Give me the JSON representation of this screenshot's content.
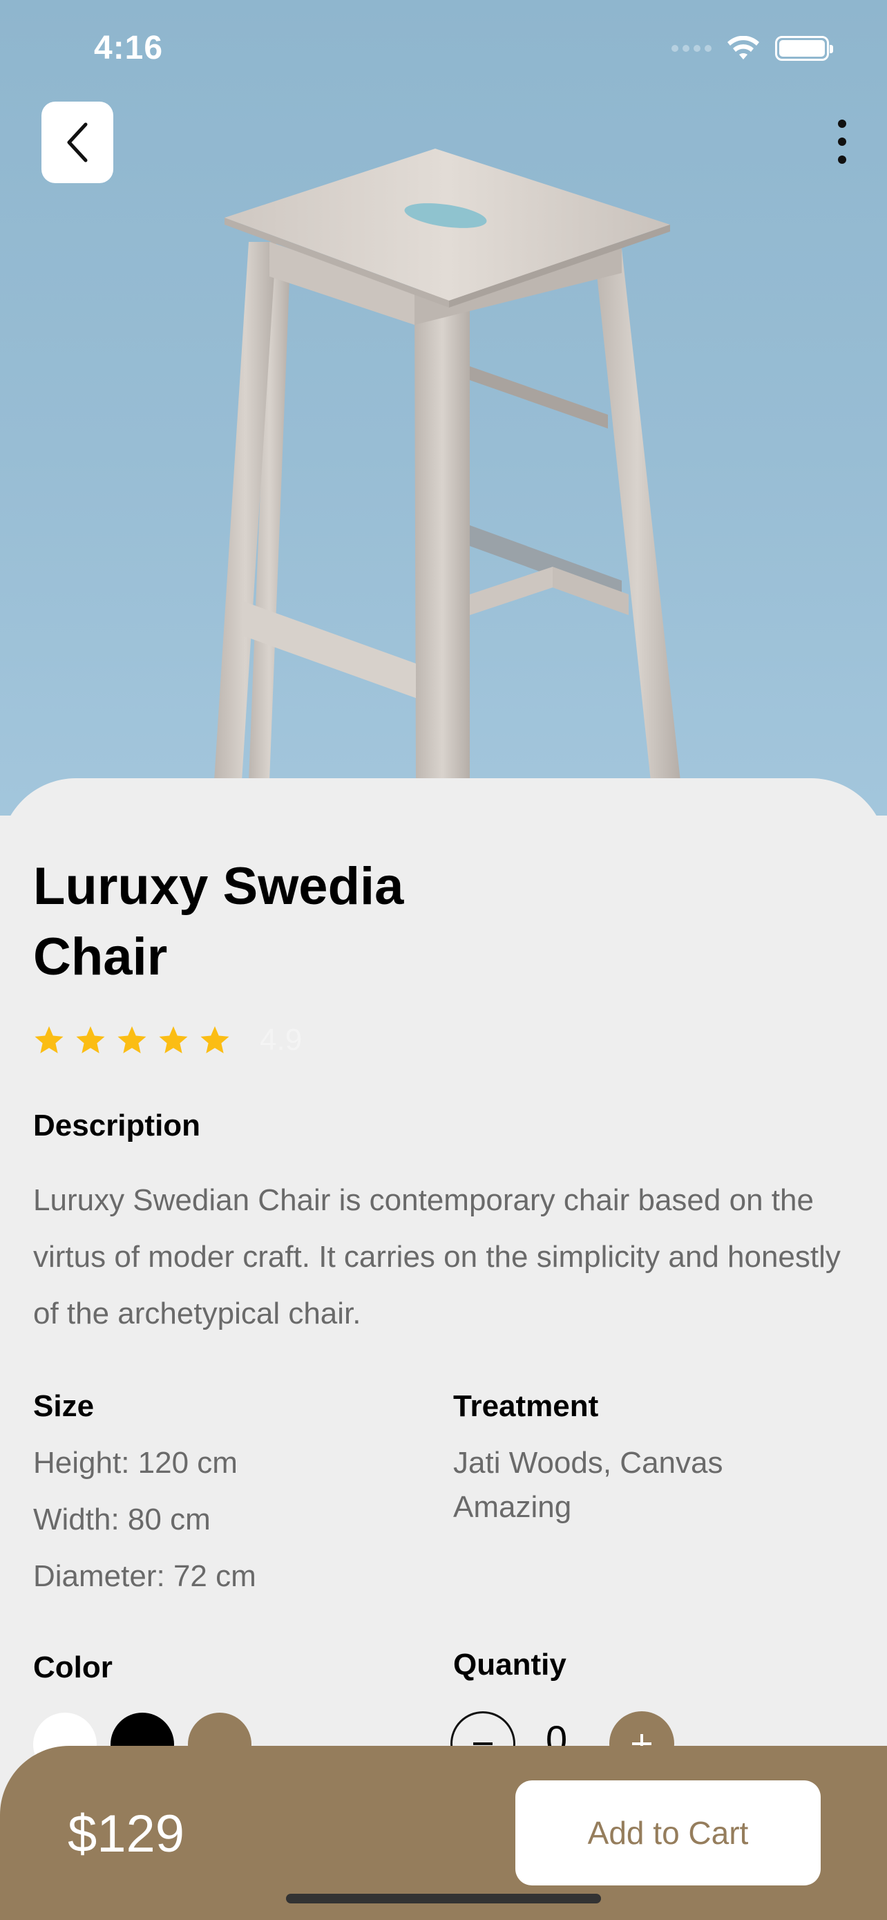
{
  "status_bar": {
    "time": "4:16"
  },
  "header": {
    "back_icon": "chevron-left-icon",
    "more_icon": "vertical-ellipsis-icon"
  },
  "product": {
    "title_line1": "Luruxy Swedia",
    "title_line2": "Chair",
    "rating": {
      "stars": 5,
      "value": "4.9",
      "star_color": "#fbbd14"
    },
    "description_label": "Description",
    "description": "Luruxy Swedian Chair is contemporary chair based on the virtus of moder craft. It carries on the simplicity and honestly of the archetypical chair.",
    "size_label": "Size",
    "size_lines": [
      "Height: 120 cm",
      "Width: 80 cm",
      "Diameter: 72 cm"
    ],
    "treatment_label": "Treatment",
    "treatment_lines": [
      "Jati Woods, Canvas",
      "Amazing"
    ],
    "color_label": "Color",
    "colors": [
      "#ffffff",
      "#000000",
      "#957d5c"
    ],
    "quantity_label": "Quantiy",
    "quantity": "0"
  },
  "cart": {
    "price": "$129",
    "add_label": "Add to Cart",
    "accent": "#957d5c"
  }
}
